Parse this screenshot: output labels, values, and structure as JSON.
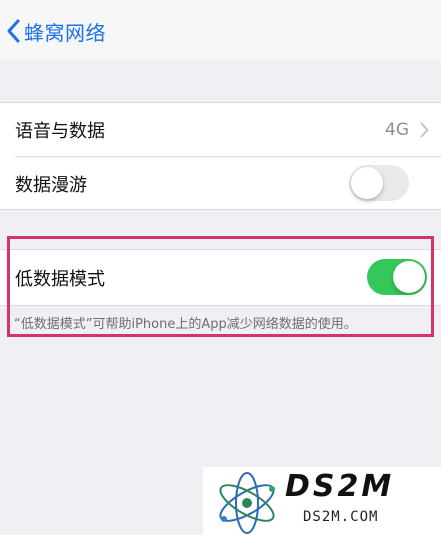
{
  "nav": {
    "back_label": "蜂窝网络"
  },
  "settings": {
    "voice_data": {
      "label": "语音与数据",
      "value": "4G"
    },
    "data_roaming": {
      "label": "数据漫游",
      "toggle_on": false
    }
  },
  "low_data_mode": {
    "label": "低数据模式",
    "toggle_on": true,
    "footer": "“低数据模式”可帮助iPhone上的App减少网络数据的使用。"
  },
  "watermark": {
    "brand": "DS2M",
    "domain": "DS2M.COM"
  },
  "colors": {
    "accent": "#1a73e8",
    "toggle_on": "#34c759",
    "highlight": "#d6336c"
  }
}
